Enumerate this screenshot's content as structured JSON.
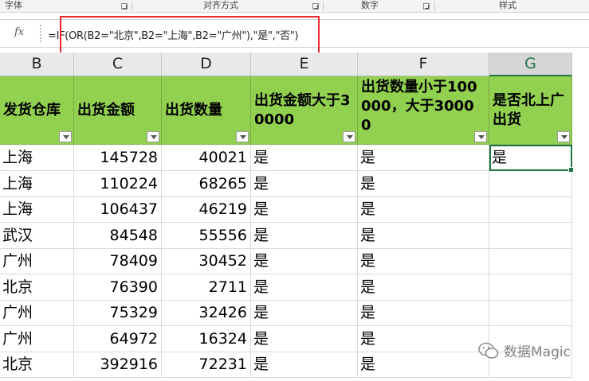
{
  "ribbon": {
    "groups": [
      "字体",
      "对齐方式",
      "数字",
      "样式"
    ]
  },
  "formula_bar": {
    "fx_label": "fx",
    "formula": "=IF(OR(B2=\"北京\",B2=\"上海\",B2=\"广州\"),\"是\",\"否\")"
  },
  "columns": [
    "B",
    "C",
    "D",
    "E",
    "F",
    "G"
  ],
  "selected_column": "G",
  "headers": [
    "发货仓库",
    "出货金额",
    "出货数量",
    "出货金额大于30000",
    "出货数量小于100000，大于30000",
    "是否北上广出货"
  ],
  "rows": [
    {
      "warehouse": "上海",
      "amount": "145728",
      "qty": "40021",
      "e": "是",
      "f": "是",
      "g": "是"
    },
    {
      "warehouse": "上海",
      "amount": "110224",
      "qty": "68265",
      "e": "是",
      "f": "是",
      "g": ""
    },
    {
      "warehouse": "上海",
      "amount": "106437",
      "qty": "46219",
      "e": "是",
      "f": "是",
      "g": ""
    },
    {
      "warehouse": "武汉",
      "amount": "84548",
      "qty": "55556",
      "e": "是",
      "f": "是",
      "g": ""
    },
    {
      "warehouse": "广州",
      "amount": "78409",
      "qty": "30452",
      "e": "是",
      "f": "是",
      "g": ""
    },
    {
      "warehouse": "北京",
      "amount": "76390",
      "qty": "2711",
      "e": "是",
      "f": "是",
      "g": ""
    },
    {
      "warehouse": "广州",
      "amount": "75329",
      "qty": "32426",
      "e": "是",
      "f": "是",
      "g": ""
    },
    {
      "warehouse": "广州",
      "amount": "64972",
      "qty": "16324",
      "e": "是",
      "f": "是",
      "g": ""
    },
    {
      "warehouse": "北京",
      "amount": "392916",
      "qty": "72231",
      "e": "是",
      "f": "是",
      "g": ""
    }
  ],
  "watermark": "数据Magic",
  "colors": {
    "header_fill": "#92d050",
    "selection": "#217346",
    "highlight_box": "#e8262b"
  }
}
